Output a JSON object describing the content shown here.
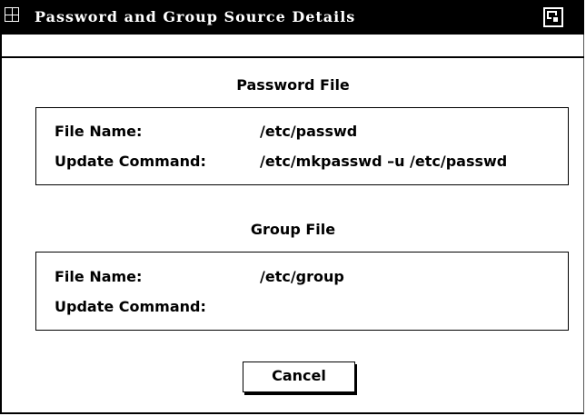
{
  "window": {
    "title": "Password and Group Source Details"
  },
  "password_section": {
    "heading": "Password File",
    "file_name_label": "File Name:",
    "file_name_value": "/etc/passwd",
    "update_command_label": "Update Command:",
    "update_command_value": "/etc/mkpasswd –u /etc/passwd"
  },
  "group_section": {
    "heading": "Group File",
    "file_name_label": "File Name:",
    "file_name_value": "/etc/group",
    "update_command_label": "Update Command:",
    "update_command_value": ""
  },
  "buttons": {
    "cancel_label": "Cancel"
  }
}
